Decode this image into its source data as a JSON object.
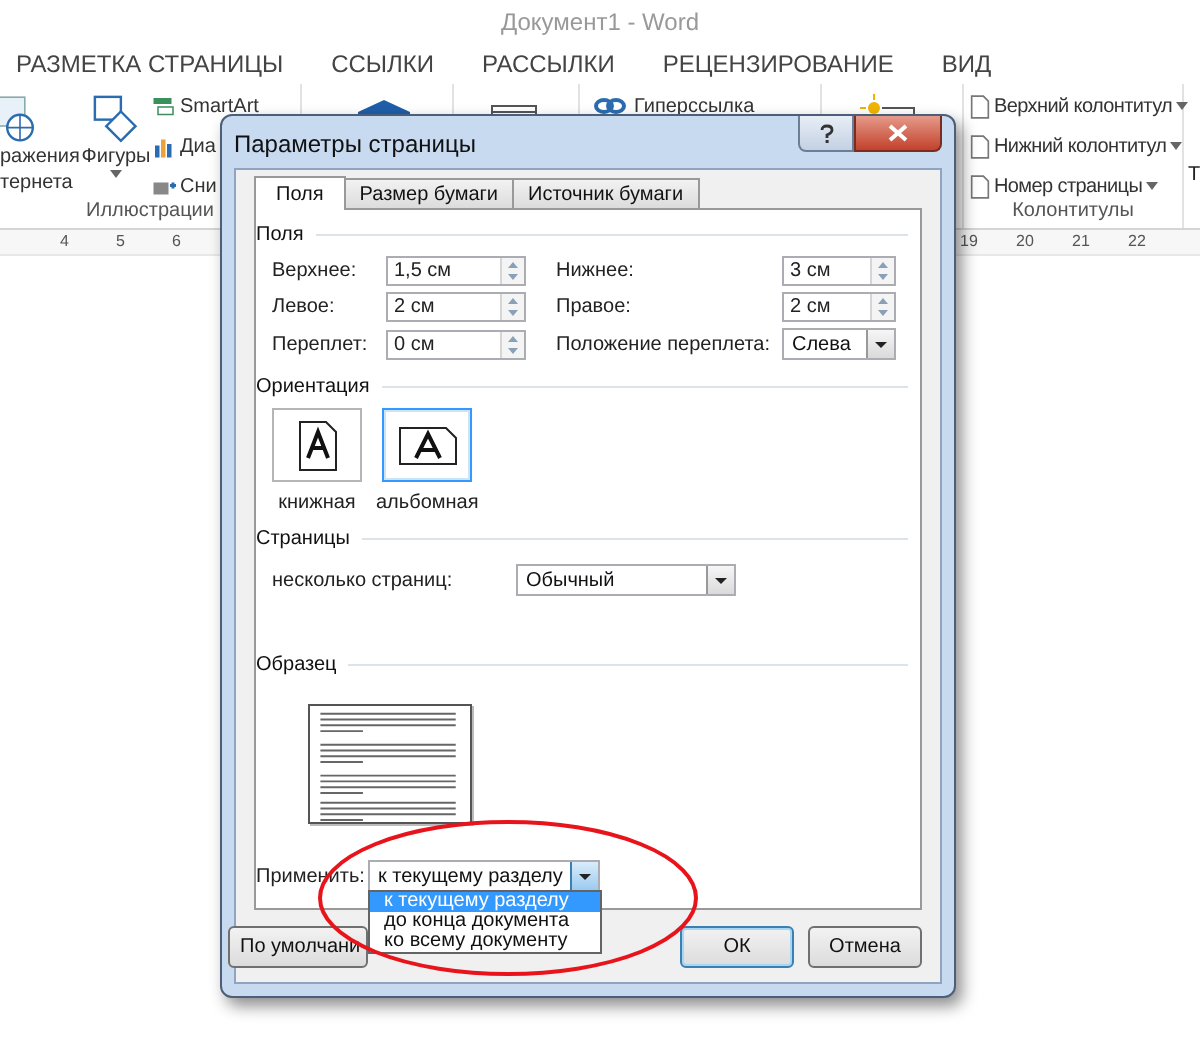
{
  "app": {
    "title": "Документ1 - Word"
  },
  "ribbon_tabs": [
    "РАЗМЕТКА СТРАНИЦЫ",
    "ССЫЛКИ",
    "РАССЫЛКИ",
    "РЕЦЕНЗИРОВАНИЕ",
    "ВИД"
  ],
  "ribbon": {
    "illustrations": {
      "pictures_label_lines": [
        "ражения",
        "тернета"
      ],
      "shapes": "Фигуры",
      "small_buttons": [
        "SmartArt",
        "Диа",
        "Сни"
      ],
      "group_label": "Иллюстрации"
    },
    "links": {
      "small_buttons": [
        "Гиперссылка"
      ]
    },
    "header_footer": {
      "small_buttons": [
        "Верхний колонтитул",
        "Нижний колонтитул",
        "Номер страницы"
      ],
      "group_label": "Колонтитулы"
    },
    "text_group_partial": "Т"
  },
  "ruler": {
    "left_numbers": [
      "4",
      "5",
      "6"
    ],
    "right_numbers": [
      "19",
      "20",
      "21",
      "22"
    ]
  },
  "dialog": {
    "title": "Параметры страницы",
    "tabs": [
      {
        "label": "Поля",
        "selected": true
      },
      {
        "label": "Размер бумаги",
        "selected": false
      },
      {
        "label": "Источник бумаги",
        "selected": false
      }
    ],
    "margins": {
      "title": "Поля",
      "fields": [
        {
          "label": "Верхнее:",
          "value": "1,5 см"
        },
        {
          "label": "Нижнее:",
          "value": "3 см"
        },
        {
          "label": "Левое:",
          "value": "2 см"
        },
        {
          "label": "Правое:",
          "value": "2 см"
        },
        {
          "label": "Переплет:",
          "value": "0 см"
        }
      ],
      "gutter_position": {
        "label": "Положение переплета:",
        "value": "Слева"
      }
    },
    "orientation": {
      "title": "Ориентация",
      "options": [
        {
          "kind": "portrait",
          "label": "книжная",
          "selected": false
        },
        {
          "kind": "landscape",
          "label": "альбомная",
          "selected": true
        }
      ]
    },
    "pages": {
      "title": "Страницы",
      "label": "несколько страниц:",
      "value": "Обычный"
    },
    "preview": {
      "title": "Образец"
    },
    "apply": {
      "label": "Применить:",
      "value": "к текущему разделу",
      "expanded": true,
      "options": [
        {
          "label": "к текущему разделу",
          "selected": true
        },
        {
          "label": "до конца документа",
          "selected": false
        },
        {
          "label": "ко всему документу",
          "selected": false
        }
      ]
    },
    "buttons": {
      "default": "По умолчани",
      "ok": "ОК",
      "cancel": "Отмена"
    }
  }
}
